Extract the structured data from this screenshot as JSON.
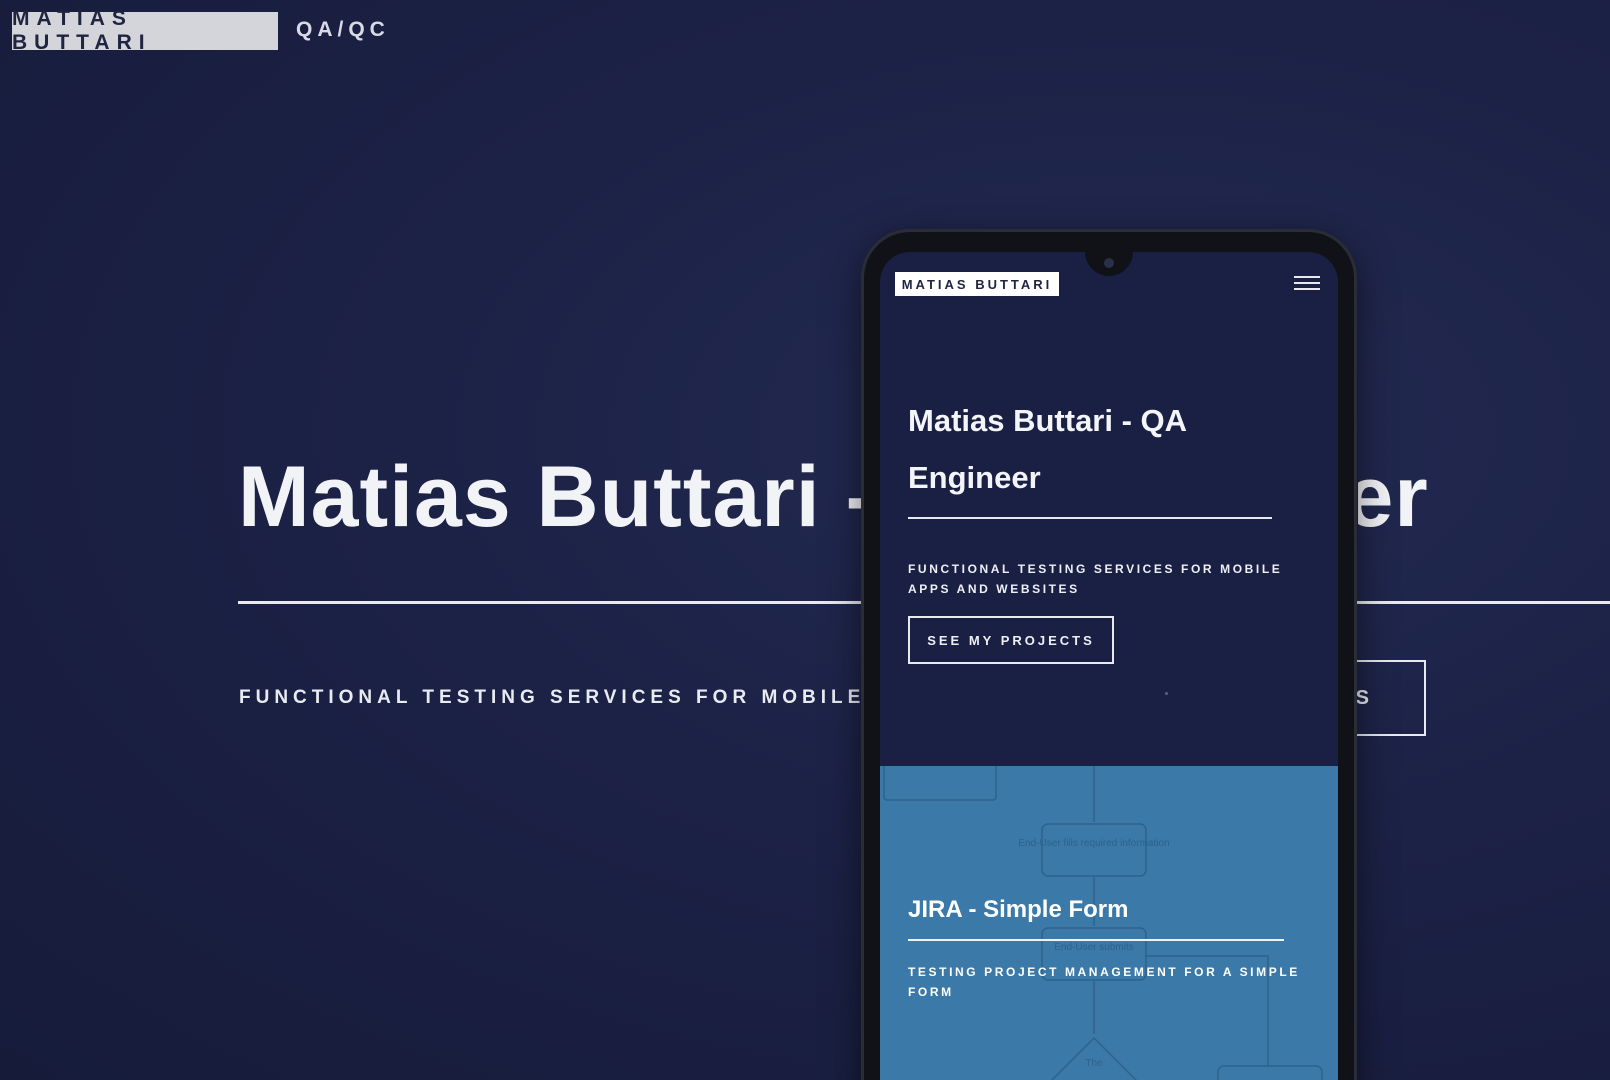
{
  "header": {
    "brand": "MATIAS BUTTARI",
    "tagline": "QA/QC"
  },
  "hero": {
    "title": "Matias Buttari - QA Engineer",
    "subtitle": "FUNCTIONAL TESTING SERVICES FOR MOBILE APPS",
    "button_label_visible": "TS"
  },
  "mobile": {
    "brand": "MATIAS BUTTARI",
    "menu_icon": "hamburger-icon",
    "hero_title": "Matias Buttari - QA Engineer",
    "hero_subtitle": "FUNCTIONAL TESTING SERVICES FOR MOBILE APPS AND WEBSITES",
    "cta_label": "SEE MY PROJECTS",
    "project": {
      "title": "JIRA - Simple Form",
      "subtitle": "TESTING PROJECT MANAGEMENT FOR A SIMPLE FORM",
      "flow_labels": [
        "End-User fills required information",
        "End-User submits",
        "The"
      ]
    }
  },
  "colors": {
    "background": "#1b2142",
    "brand_box": "#d3d5da",
    "text": "#f2f3f7",
    "project_card": "#3a79a8"
  }
}
